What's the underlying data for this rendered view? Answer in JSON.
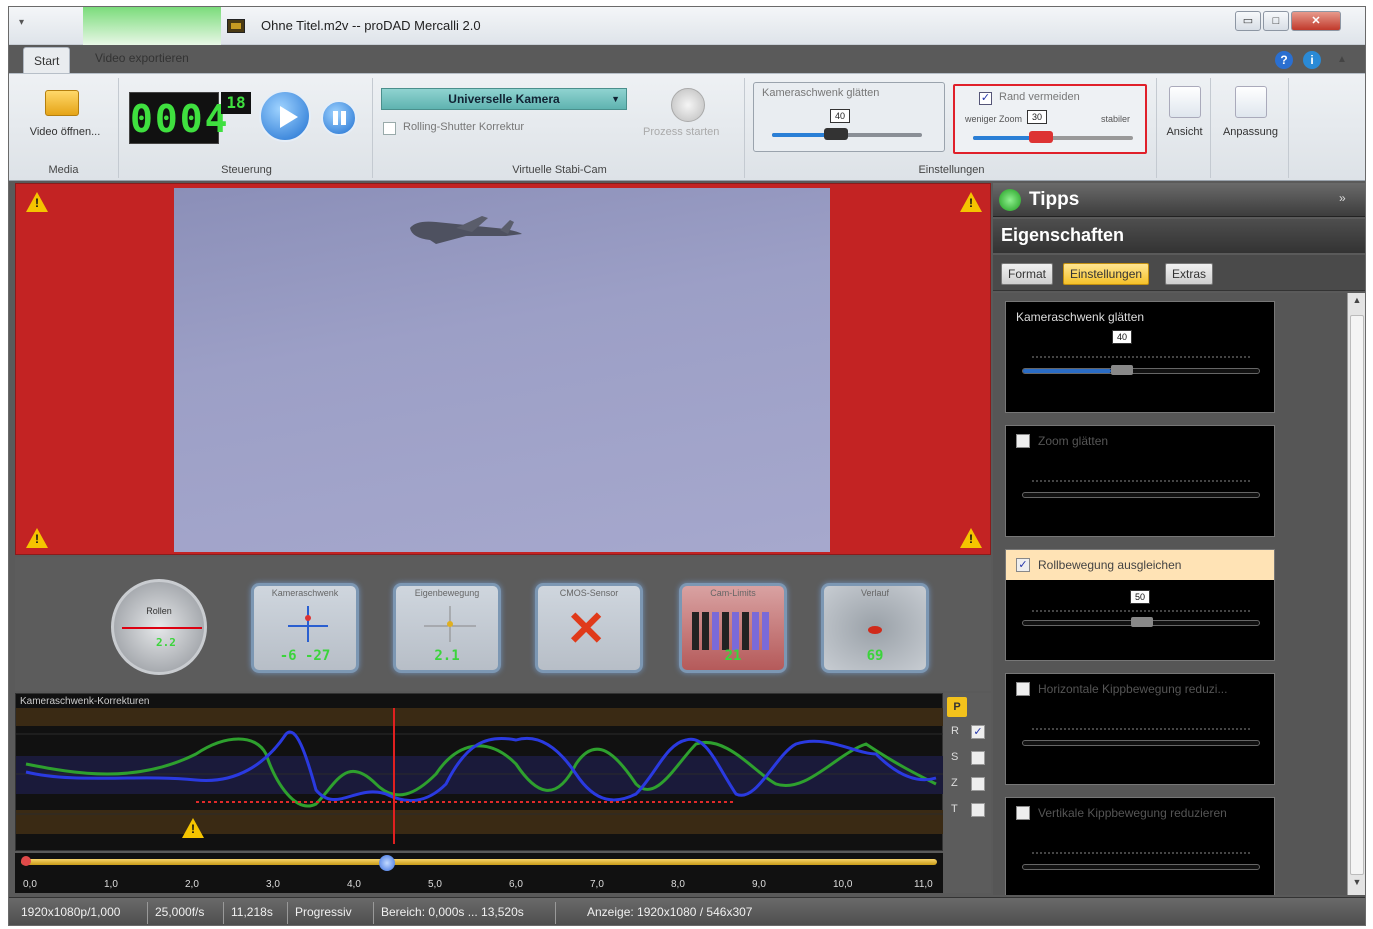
{
  "window": {
    "title": "Ohne Titel.m2v -- proDAD Mercalli 2.0",
    "controls": {
      "minimize": "▭",
      "maximize": "□",
      "close": "✕"
    }
  },
  "tabs": [
    "Start",
    "Video exportieren"
  ],
  "ribbon": {
    "media": {
      "open_label": "Video öffnen...",
      "group_label": "Media"
    },
    "steuerung": {
      "counter": "0004",
      "counter_small": "18",
      "group_label": "Steuerung"
    },
    "stabicam": {
      "camera_select": "Universelle Kamera",
      "rolling_shutter_label": "Rolling-Shutter Korrektur",
      "start_label": "Prozess starten",
      "group_label": "Virtuelle Stabi-Cam"
    },
    "einstellungen": {
      "smooth_label": "Kameraschwenk glätten",
      "smooth_value": "40",
      "rand_label": "Rand vermeiden",
      "rand_weniger": "weniger Zoom",
      "rand_value": "30",
      "rand_stabiler": "stabiler",
      "group_label": "Einstellungen"
    },
    "ansicht_label": "Ansicht",
    "anpassung_label": "Anpassung"
  },
  "gauges": {
    "roll": {
      "label": "Rollen",
      "value": "2.2"
    },
    "kameraschwenk": {
      "label": "Kameraschwenk",
      "value": "-6  -27"
    },
    "eigenbewegung": {
      "label": "Eigenbewegung",
      "value": "2.1"
    },
    "cmos": {
      "label": "CMOS-Sensor"
    },
    "cam_limits": {
      "label": "Cam-Limits",
      "value": "21"
    },
    "verlauf": {
      "label": "Verlauf",
      "value": "69"
    }
  },
  "graph": {
    "title": "Kameraschwenk-Korrekturen",
    "side": {
      "p": "P",
      "rows": [
        "R",
        "S",
        "Z",
        "T"
      ]
    }
  },
  "timeline": {
    "labels": [
      "0,0",
      "1,0",
      "2,0",
      "3,0",
      "4,0",
      "5,0",
      "6,0",
      "7,0",
      "8,0",
      "9,0",
      "10,0",
      "11,0"
    ],
    "position": 0.4
  },
  "statusbar": {
    "resolution": "1920x1080p/1,000",
    "fps": "25,000f/s",
    "duration": "11,218s",
    "scan": "Progressiv",
    "range": "Bereich:  0,000s ... 13,520s",
    "display": "Anzeige:  1920x1080 / 546x307"
  },
  "panel": {
    "tipps": "Tipps",
    "eigenschaften": "Eigenschaften",
    "tabs": [
      "Format",
      "Einstellungen",
      "Extras"
    ],
    "cards": [
      {
        "label": "Kameraschwenk glätten",
        "value": "40",
        "checked": null
      },
      {
        "label": "Zoom glätten",
        "value": "",
        "checked": false
      },
      {
        "label": "Rollbewegung ausgleichen",
        "value": "50",
        "checked": true
      },
      {
        "label": "Horizontale Kippbewegung reduzi...",
        "value": "",
        "checked": false
      },
      {
        "label": "Vertikale Kippbewegung reduzieren",
        "value": "",
        "checked": false
      }
    ]
  },
  "colors": {
    "preview_border": "#c32323",
    "accent_blue": "#2a7fd6",
    "highlight": "#f5c22a",
    "green_readout": "#3bd43b"
  }
}
